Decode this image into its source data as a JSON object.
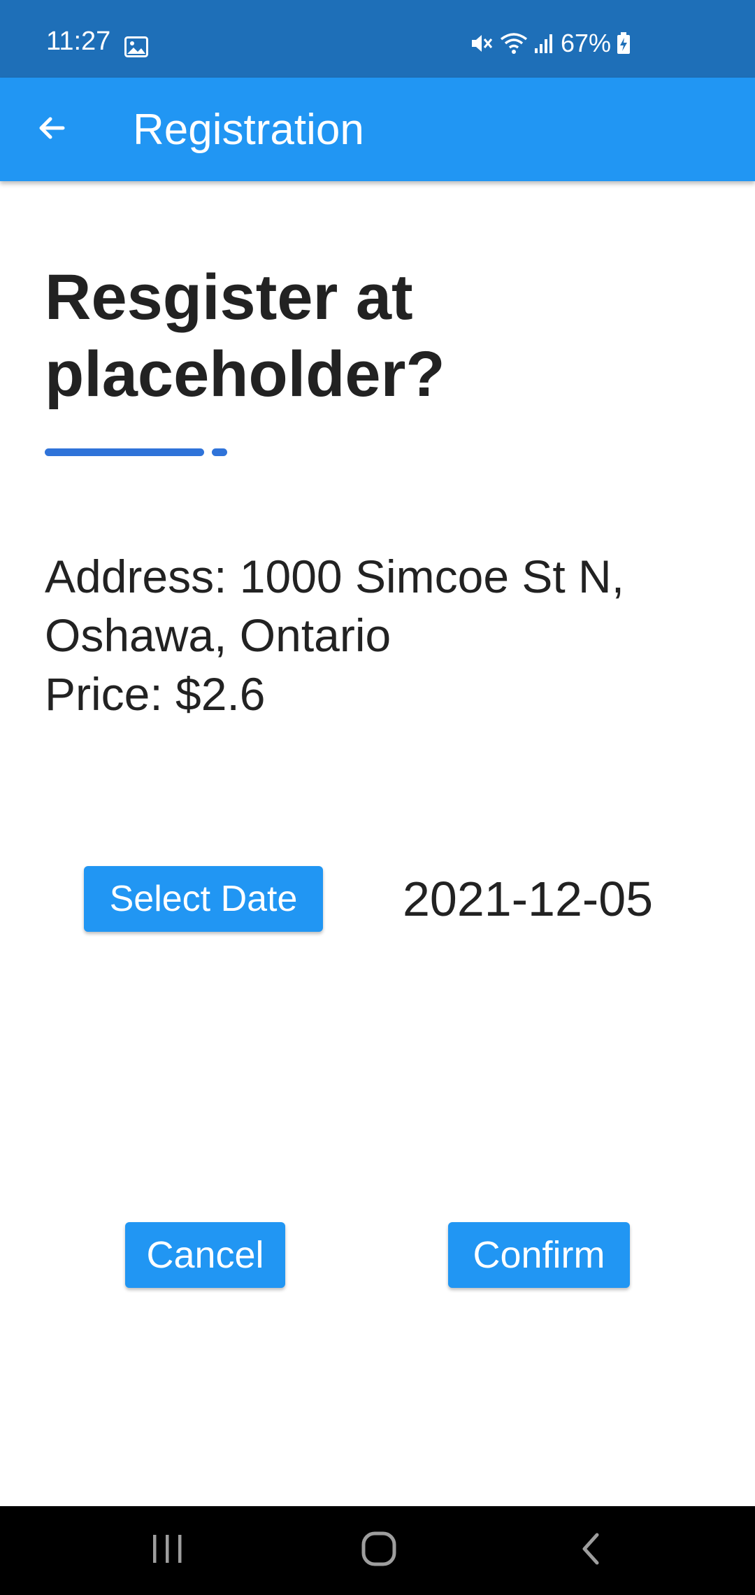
{
  "status_bar": {
    "time": "11:27",
    "battery_percent": "67%",
    "icons": [
      "gallery-icon",
      "mute-icon",
      "wifi-icon",
      "signal-icon",
      "battery-charging-icon"
    ]
  },
  "app_bar": {
    "title": "Registration",
    "back_icon": "arrow-left-icon"
  },
  "content": {
    "heading": "Resgister at placeholder?",
    "address_line1": "Address: 1000 Simcoe St N,",
    "address_line2": "Oshawa, Ontario",
    "price": "Price: $2.6",
    "select_date_label": "Select Date",
    "selected_date": "2021-12-05",
    "cancel_label": "Cancel",
    "confirm_label": "Confirm"
  },
  "nav_bar": {
    "icons": [
      "recents-icon",
      "home-icon",
      "back-icon"
    ]
  },
  "colors": {
    "status_bar": "#1e6fb8",
    "app_bar": "#2196f3",
    "button": "#2196f3",
    "accent_underline": "#2f73d9",
    "text": "#222222",
    "nav_bar": "#000000"
  }
}
